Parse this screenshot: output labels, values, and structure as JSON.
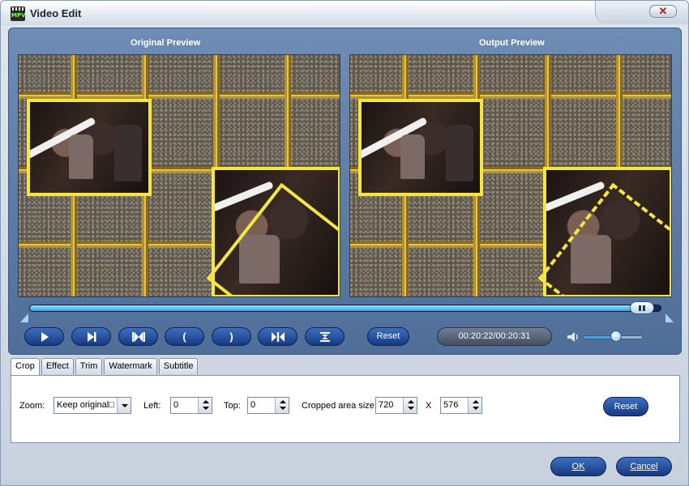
{
  "window": {
    "title": "Video Edit",
    "icon_label": "MPV",
    "close_glyph": "✕"
  },
  "preview": {
    "original_label": "Original Preview",
    "output_label": "Output Preview"
  },
  "playback": {
    "progress": 0.985,
    "time": "00:20:22/00:20:31",
    "reset_label": "Reset",
    "volume": 0.55,
    "buttons": [
      {
        "name": "play-button",
        "icon": "play-icon"
      },
      {
        "name": "next-frame-button",
        "icon": "step-forward-icon"
      },
      {
        "name": "snapshot-button",
        "icon": "snapshot-icon"
      },
      {
        "name": "mark-in-button",
        "glyph": "("
      },
      {
        "name": "mark-out-button",
        "glyph": ")"
      },
      {
        "name": "split-button",
        "icon": "split-icon"
      },
      {
        "name": "trim-button",
        "icon": "trim-icon"
      }
    ]
  },
  "tabs": [
    "Crop",
    "Effect",
    "Trim",
    "Watermark",
    "Subtitle"
  ],
  "crop": {
    "zoom_label": "Zoom:",
    "zoom_value": "Keep original□",
    "left_label": "Left:",
    "left_value": "0",
    "top_label": "Top:",
    "top_value": "0",
    "size_label": "Cropped area size:",
    "width_value": "720",
    "x_label": "X",
    "height_value": "576",
    "reset_label": "Reset"
  },
  "footer": {
    "ok_label": "OK",
    "cancel_label": "Cancel"
  },
  "colors": {
    "accent": "#163a80",
    "panel": "#5a7aa5",
    "frame_yellow": "#f4e540"
  }
}
